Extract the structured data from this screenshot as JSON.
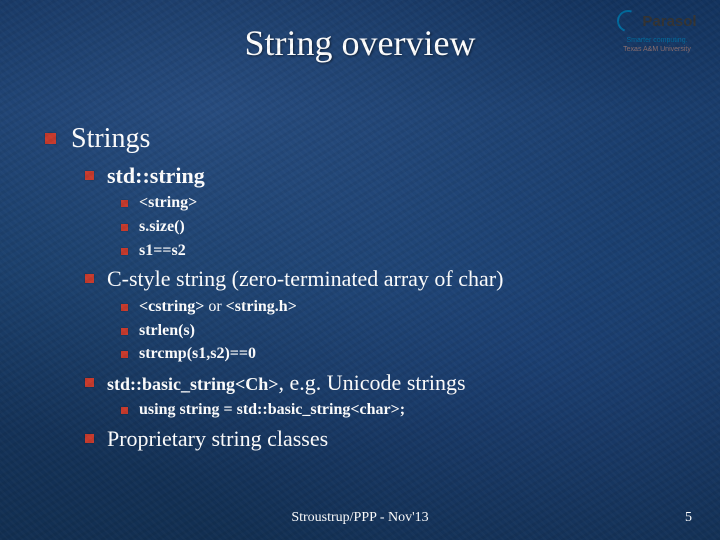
{
  "title": "String overview",
  "logo": {
    "name": "Parasol",
    "tagline": "Smarter computing.",
    "university": "Texas A&M University"
  },
  "content": {
    "main": "Strings",
    "items": [
      {
        "label_bold": "std::string",
        "label_tail": "",
        "sub": [
          "<string>",
          "s.size()",
          "s1==s2"
        ]
      },
      {
        "label_bold": "",
        "label_tail": "C-style string (zero-terminated array of char)",
        "sub_mixed": [
          {
            "b1": "<cstring>",
            "p": " or ",
            "b2": "<string.h>"
          }
        ],
        "sub": [
          "strlen(s)",
          "strcmp(s1,s2)==0"
        ]
      },
      {
        "label_bold": "std::basic_string<Ch>",
        "label_tail": ", e.g. Unicode strings",
        "sub": [
          "using string = std::basic_string<char>;"
        ]
      },
      {
        "label_bold": "",
        "label_tail": "Proprietary string classes",
        "sub": []
      }
    ]
  },
  "footer": "Stroustrup/PPP - Nov'13",
  "page": "5"
}
